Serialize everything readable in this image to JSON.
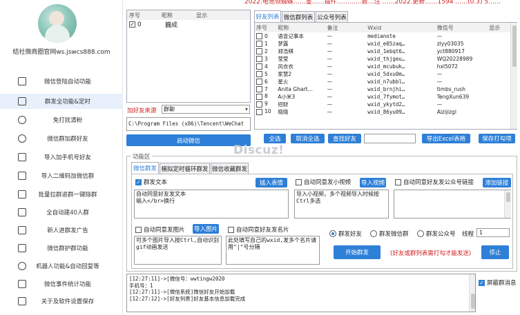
{
  "banner": {
    "text": "2022.电池领蜘蛛……鉴……插件…………数…注 ……2022.更新……1594 ……(0.3) 5……"
  },
  "sidebar": {
    "site": "结社微商圈官网ws.jswcs888.com",
    "items": [
      {
        "label": "微信登陆自动功能",
        "icon": "layers-icon"
      },
      {
        "label": "群发全功能&定时",
        "icon": "folder-icon"
      },
      {
        "label": "免打扰清粉",
        "icon": "user-run-icon"
      },
      {
        "label": "微信群加群好友",
        "icon": "user-add-icon"
      },
      {
        "label": "导入加手机号好友",
        "icon": "upload-icon"
      },
      {
        "label": "导入二维码加微信群",
        "icon": "grid-icon"
      },
      {
        "label": "批量拉群退群一键除群",
        "icon": "grid-icon"
      },
      {
        "label": "全自动建40人群",
        "icon": "grid-icon"
      },
      {
        "label": "新人进群发广告",
        "icon": "grid-icon"
      },
      {
        "label": "微信群护群功能",
        "icon": "grid-icon"
      },
      {
        "label": "机器人功能&自动回复等",
        "icon": "clock-icon"
      },
      {
        "label": "微信事件统计功能",
        "icon": "trash-icon"
      },
      {
        "label": "关于及软件设置保存",
        "icon": "calendar-icon"
      }
    ]
  },
  "accounts": {
    "headers": [
      "序号",
      "昵称",
      "显示"
    ],
    "rows": [
      {
        "id": "0",
        "nick": "巍成",
        "checked": true
      }
    ],
    "source_label": "加好友来源",
    "source_value": "群聊",
    "path": "C:\\Program Files (x86)\\Tencent\\WeChat",
    "start_btn": "启动微信"
  },
  "list_tabs": [
    "好友列表",
    "微信群列表",
    "公众号列表"
  ],
  "friends": {
    "headers": [
      "序号",
      "昵称",
      "备注",
      "Wxid",
      "微信号",
      "显示"
    ],
    "rows": [
      [
        "0",
        "语音记事本",
        "—",
        "medianote",
        "—"
      ],
      [
        "1",
        "梦露",
        "—",
        "wxid_e05zaq…",
        "zlyy03035"
      ],
      [
        "2",
        "郑浩棋",
        "—",
        "wxid_1ebqt6…",
        "yct880917"
      ],
      [
        "3",
        "莹莹",
        "—",
        "wxid_thjgeu…",
        "WQ20228989"
      ],
      [
        "4",
        "风衣衣",
        "—",
        "wxid_mcubuk…",
        "hxl5072"
      ],
      [
        "5",
        "家慧2",
        "—",
        "wxid_5dxu0m…",
        "—"
      ],
      [
        "6",
        "星火",
        "—",
        "wxid_n7ubbl…",
        "—"
      ],
      [
        "7",
        "Anita Ghart…",
        "—",
        "wxid_brnjhi…",
        "timbs_rush"
      ],
      [
        "8",
        "A小米3",
        "—",
        "wxid_7fymot…",
        "TengXun639"
      ],
      [
        "9",
        "招财",
        "—",
        "wxid_ykytd2…",
        "—"
      ],
      [
        "10",
        "晓晓",
        "—",
        "wxid_86yu09…",
        "Aizijizgl"
      ]
    ],
    "buttons": [
      "全选",
      "取消全选",
      "查找好友",
      "导出Excel表格",
      "保存打勾项"
    ]
  },
  "watermark": "Discuz!",
  "func": {
    "legend": "功能区",
    "tabs": [
      "微信群发",
      "模拟定时循环群发",
      "微信收藏群发"
    ],
    "text_check": "群发文本",
    "insert_emoji": "插入表情",
    "text_value": "自动同意好友发文本\n输入</br>换行",
    "video_check": "自动同意发小视频",
    "import_video": "导入视频",
    "video_value": "导入小视频，多个视频导入时候按\nCtrl多选",
    "public_check": "自动同意好友发公众号链接",
    "add_link": "添加链接",
    "image_check": "自动同意发图片",
    "import_image": "导入图片",
    "image_value": "可多个图片导入按Ctrl,自动识别\ngif动画发送",
    "card_check": "自动同意好友发名片",
    "card_value": "此处填写自己的wxid,发多个名片请\n用\"|\"号分隔",
    "radios": [
      "群发好友",
      "群发微信群",
      "群发公众号"
    ],
    "interval_label": "线程",
    "interval_value": "1",
    "start_btn": "开始群发",
    "note": "(好友或群列表需打勾才能发送)",
    "stop_btn": "停止"
  },
  "log": {
    "lines": [
      "[12:27:11]->[微信号：wwtingw2020",
      "手机号：1",
      "[12:27:11]->[微信系统]微信好友开始加载",
      "[12:27:12]->[好友列表]好友基本信息加载完成"
    ],
    "shield_label": "屏蔽群消息"
  },
  "colors": {
    "accent": "#2e7fd7",
    "warn": "#d02020"
  }
}
